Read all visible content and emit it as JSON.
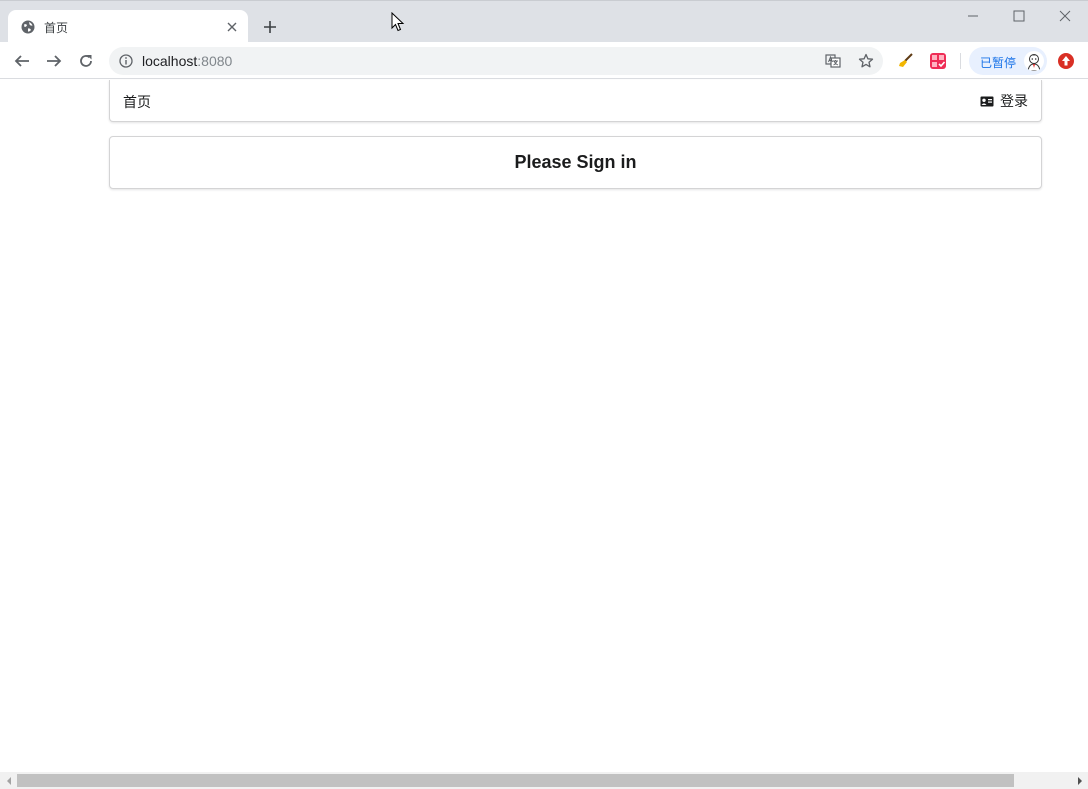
{
  "browser": {
    "tab": {
      "title": "首页",
      "favicon": "globe-icon"
    },
    "address": {
      "host": "localhost",
      "port": ":8080"
    },
    "profile": {
      "label": "已暂停"
    }
  },
  "page": {
    "navbar": {
      "home_label": "首页",
      "login_label": "登录"
    },
    "signin": {
      "heading": "Please Sign in"
    }
  },
  "colors": {
    "chrome_titlebar": "#dee1e6",
    "omnibox": "#f1f3f4",
    "paused_bg": "#e8f0fe",
    "paused_text": "#1a73e8",
    "card_border": "#d4d4d5"
  }
}
